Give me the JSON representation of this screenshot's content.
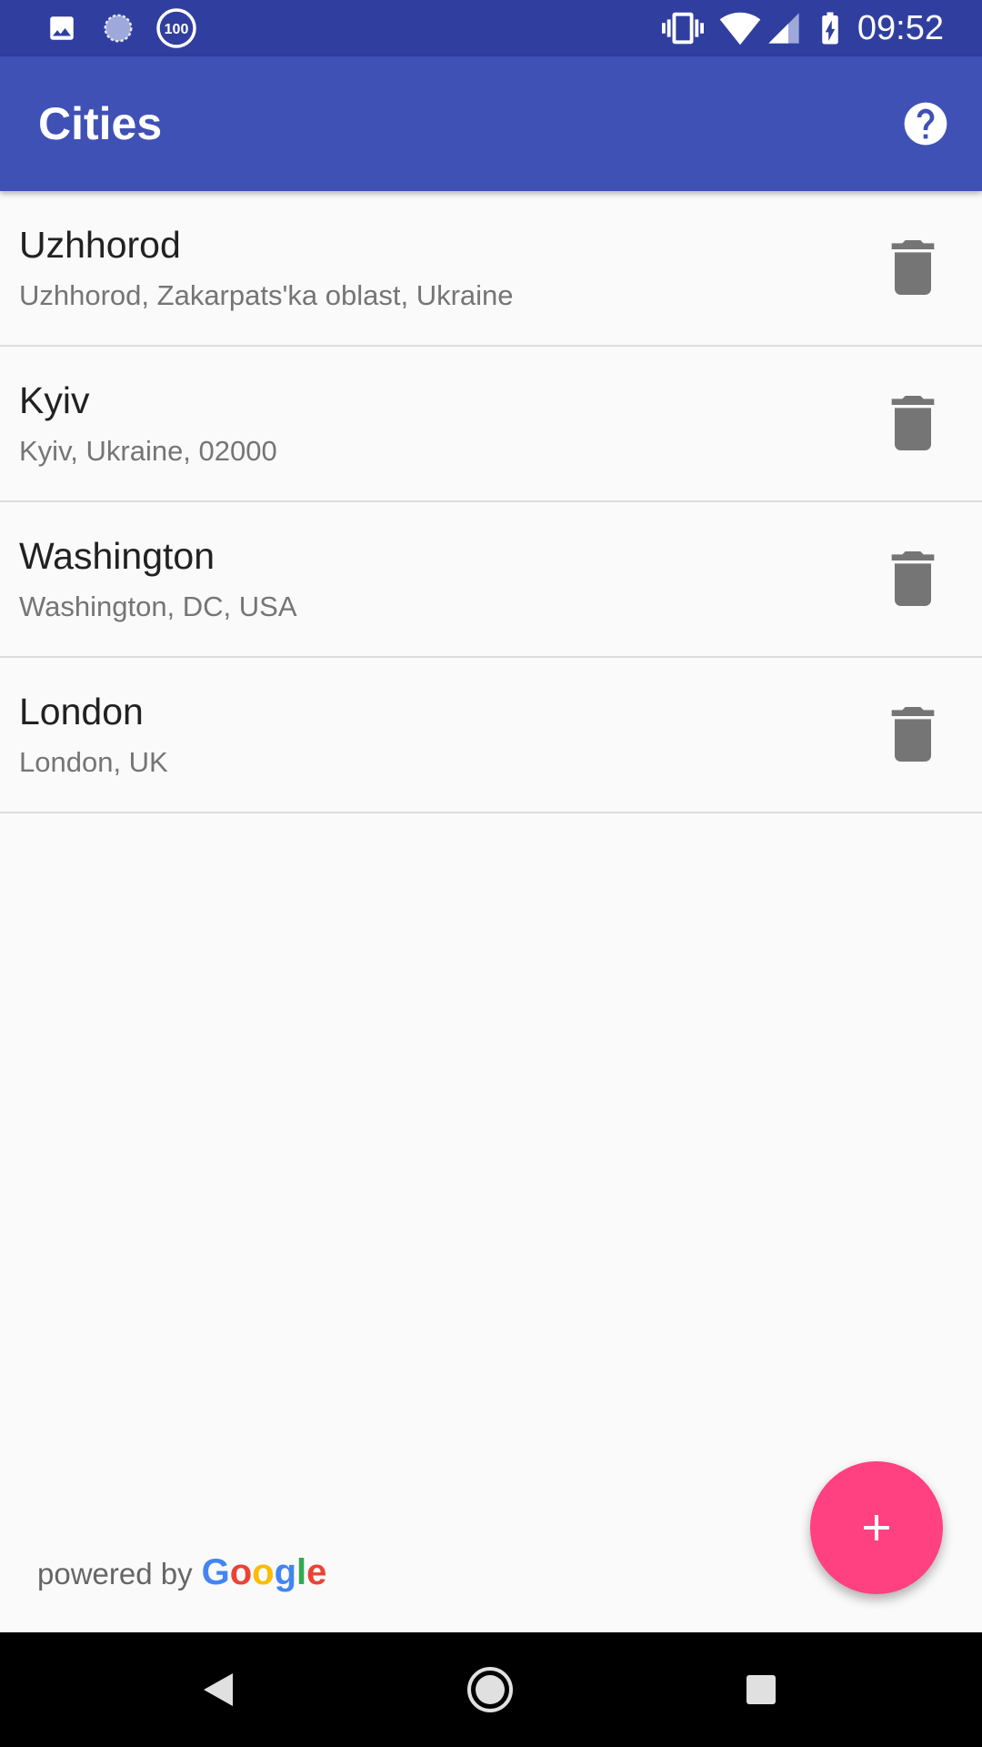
{
  "status_bar": {
    "time": "09:52",
    "icons": [
      "image-icon",
      "sync-icon",
      "battery-saver-100-icon",
      "vibrate-icon",
      "wifi-icon",
      "signal-icon",
      "battery-charging-icon"
    ],
    "badge_text": "100"
  },
  "app_bar": {
    "title": "Cities",
    "help_icon": "help-icon"
  },
  "cities": [
    {
      "name": "Uzhhorod",
      "address": "Uzhhorod, Zakarpats'ka oblast, Ukraine"
    },
    {
      "name": "Kyiv",
      "address": "Kyiv, Ukraine, 02000"
    },
    {
      "name": "Washington",
      "address": "Washington, DC, USA"
    },
    {
      "name": "London",
      "address": "London, UK"
    }
  ],
  "footer": {
    "powered_by": "powered by",
    "google_letters": [
      "G",
      "o",
      "o",
      "g",
      "l",
      "e"
    ],
    "google_colors": [
      "#4285F4",
      "#EA4335",
      "#FBBC05",
      "#4285F4",
      "#34A853",
      "#EA4335"
    ]
  },
  "fab": {
    "icon": "add-icon",
    "color": "#ff4081"
  },
  "nav_bar": {
    "buttons": [
      "back-icon",
      "home-icon",
      "recents-icon"
    ]
  },
  "colors": {
    "status_bar": "#303f9f",
    "app_bar": "#3f51b5",
    "delete_icon": "#757575",
    "background": "#fafafa"
  }
}
